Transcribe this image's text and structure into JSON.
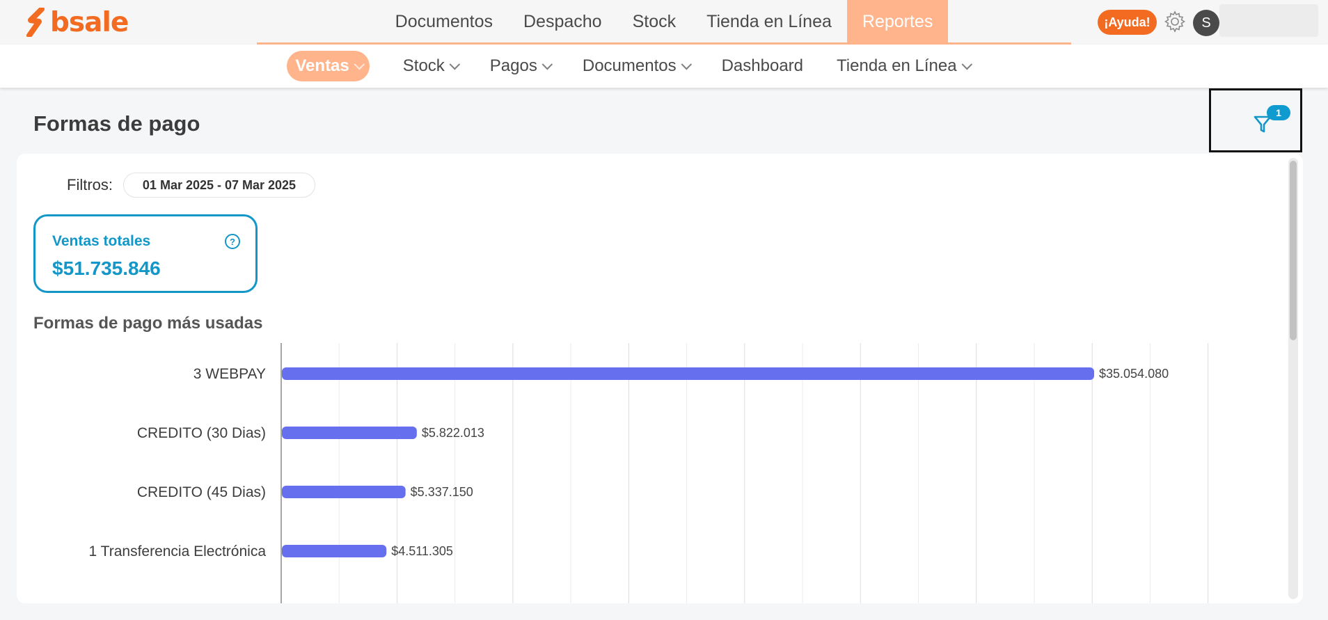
{
  "brand": {
    "name": "bsale",
    "color": "#f26b21"
  },
  "main_nav": [
    {
      "label": "Documentos",
      "active": false
    },
    {
      "label": "Despacho",
      "active": false
    },
    {
      "label": "Stock",
      "active": false
    },
    {
      "label": "Tienda en Línea",
      "active": false
    },
    {
      "label": "Reportes",
      "active": true
    }
  ],
  "header_right": {
    "help_label": "¡Ayuda!",
    "avatar_initial": "S"
  },
  "sub_nav": [
    {
      "label": "Ventas",
      "active": true,
      "dropdown": true
    },
    {
      "label": "Stock",
      "active": false,
      "dropdown": true
    },
    {
      "label": "Pagos",
      "active": false,
      "dropdown": true
    },
    {
      "label": "Documentos",
      "active": false,
      "dropdown": true
    },
    {
      "label": "Dashboard",
      "active": false,
      "dropdown": false
    },
    {
      "label": "Tienda en Línea",
      "active": false,
      "dropdown": true
    }
  ],
  "page": {
    "title": "Formas de pago",
    "filter_count": "1"
  },
  "filters": {
    "label": "Filtros:",
    "date_range": "01 Mar 2025 - 07 Mar 2025"
  },
  "kpi": {
    "label": "Ventas totales",
    "value": "$51.735.846"
  },
  "section": {
    "title": "Formas de pago más usadas"
  },
  "colors": {
    "accent": "#ffb48c",
    "kpi": "#1396c8",
    "bar": "#6670ef",
    "badge": "#0f9ad0"
  },
  "chart_data": {
    "type": "bar",
    "orientation": "horizontal",
    "categories": [
      "3 WEBPAY",
      "CREDITO (30 Dias)",
      "CREDITO (45 Dias)",
      "1 Transferencia Electrónica"
    ],
    "values": [
      35054080,
      5822013,
      5337150,
      4511305
    ],
    "value_labels": [
      "$35.054.080",
      "$5.822.013",
      "$5.337.150",
      "$4.511.305"
    ],
    "xlim": [
      0,
      40000000
    ],
    "grid": true
  }
}
